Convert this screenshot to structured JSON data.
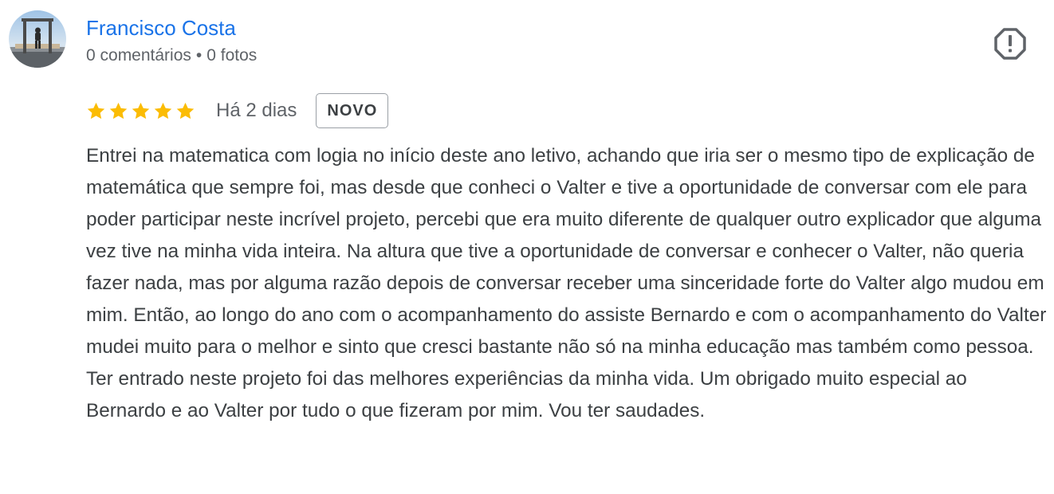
{
  "review": {
    "author": {
      "name": "Francisco Costa",
      "comments": "0 comentários",
      "separator": "•",
      "photos": "0 fotos"
    },
    "rating": {
      "stars": 5,
      "max_stars": 5,
      "star_color": "#fbbc04"
    },
    "time": "Há 2 dias",
    "badge": "NOVO",
    "text": "Entrei na matematica com logia no início deste ano letivo, achando que iria ser o mesmo tipo de explicação de matemática que sempre foi, mas desde que conheci o Valter e tive a oportunidade de conversar com ele para poder participar neste incrível projeto, percebi que era muito diferente de qualquer outro explicador que alguma vez tive na minha vida inteira. Na altura que tive a oportunidade de conversar e conhecer o Valter, não queria fazer nada, mas por alguma razão depois de conversar receber uma sinceridade forte do Valter algo mudou em mim. Então, ao longo do ano com o acompanhamento do assiste Bernardo e com o acompanhamento do Valter mudei muito para o melhor e sinto que cresci bastante não só na minha educação mas também como pessoa. Ter entrado neste projeto foi das melhores experiências da minha vida. Um obrigado muito especial ao Bernardo e ao Valter por tudo o que fizeram por mim. Vou ter saudades.",
    "flag_icon": "report-flag-icon"
  },
  "colors": {
    "author_link": "#1a73e8",
    "secondary_text": "#5f6368",
    "body_text": "#3c4043"
  }
}
